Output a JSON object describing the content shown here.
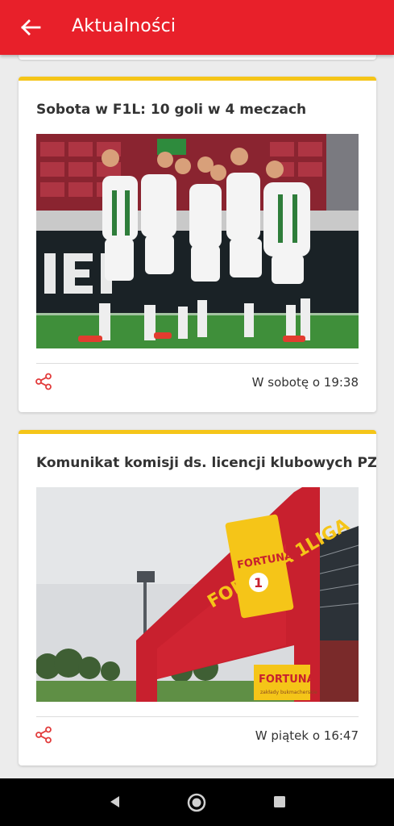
{
  "appbar": {
    "title": "Aktualności",
    "back_icon": "arrow-left-icon",
    "color": "#e8202a"
  },
  "articles": [
    {
      "title": "Sobota w F1L: 10 goli w 4 meczach",
      "image": "football-players-celebrating-photo",
      "share_icon": "share-icon",
      "time": "W sobotę o 19:38"
    },
    {
      "title": "Komunikat komisji ds. licencji klubowych PZPN",
      "image": "stadium-fortuna-1-liga-banner-photo",
      "banner_text": "FORTUNA 1 LIGA",
      "sponsor_text": "FORTUNA",
      "sponsor_subtext": "zakłady bukmacherskie",
      "share_icon": "share-icon",
      "time": "W piątek o 16:47"
    }
  ],
  "accent_color": "#f5c518",
  "system_nav": {
    "back_icon": "triangle-back-icon",
    "home_icon": "circle-home-icon",
    "recents_icon": "square-recents-icon"
  }
}
